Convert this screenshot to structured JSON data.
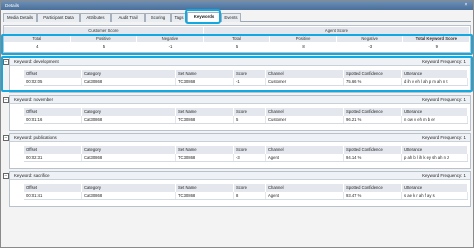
{
  "window": {
    "title": "Details",
    "close": "×"
  },
  "tabs": [
    {
      "label": "Media Details"
    },
    {
      "label": "Participant Data"
    },
    {
      "label": "Attributes"
    },
    {
      "label": "Audit Trail"
    },
    {
      "label": "Scoring"
    },
    {
      "label": "Tags"
    },
    {
      "label": "Keywords",
      "active": true
    },
    {
      "label": "Events"
    }
  ],
  "score": {
    "group_headers": [
      "Customer Score",
      "Agent Score"
    ],
    "columns": [
      "Total",
      "Positive",
      "Negative",
      "Total",
      "Positive",
      "Negative",
      "Total Keyword Score"
    ],
    "values": [
      "4",
      "5",
      "-1",
      "5",
      "8",
      "-3",
      "9"
    ]
  },
  "detail_columns": [
    "Offset",
    "Category",
    "Set Name",
    "Score",
    "Channel",
    "Spotted Confidence",
    "Utterance"
  ],
  "keywords": [
    {
      "title": "Keyword: development",
      "frequency": "Keyword Frequency: 1",
      "row": [
        "00:02:05",
        "Cat30868",
        "TC30868",
        "-1",
        "Customer",
        "75.66 %",
        "d ih v eh l ah p m ah n t"
      ]
    },
    {
      "title": "Keyword: november",
      "frequency": "Keyword Frequency: 1",
      "row": [
        "00:01:16",
        "Cat30868",
        "TC30868",
        "5",
        "Customer",
        "96.21 %",
        "n ow v eh m b er"
      ]
    },
    {
      "title": "Keyword: publications",
      "frequency": "Keyword Frequency: 1",
      "row": [
        "00:02:31",
        "Cat30868",
        "TC30868",
        "-3",
        "Agent",
        "94.14 %",
        "p ah b l ih k ey sh ah n z"
      ]
    },
    {
      "title": "Keyword: sacrifice",
      "frequency": "Keyword Frequency: 1",
      "row": [
        "00:01:41",
        "Cat30868",
        "TC30868",
        "8",
        "Agent",
        "93.47 %",
        "s ae k r ah f ay s"
      ]
    }
  ]
}
